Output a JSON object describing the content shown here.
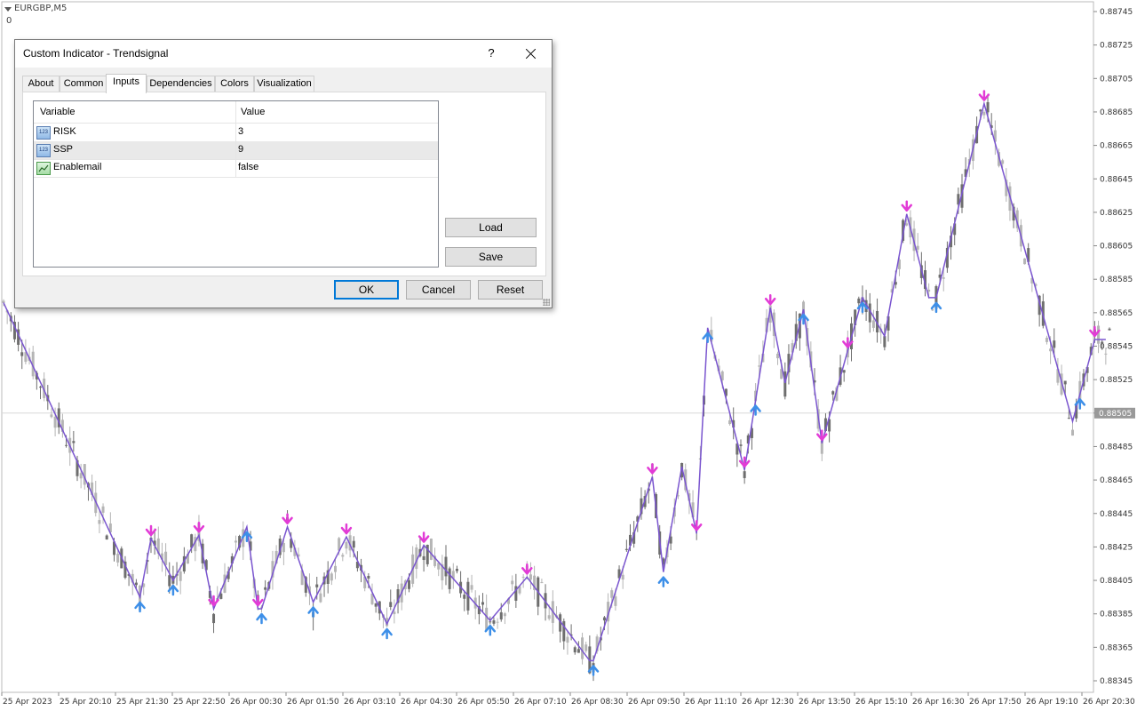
{
  "chart": {
    "symbol": "EURGBP,M5",
    "sub_label": "0",
    "current_price": "0.88505",
    "price_labels": [
      "0.88745",
      "0.88725",
      "0.88705",
      "0.88685",
      "0.88665",
      "0.88645",
      "0.88625",
      "0.88605",
      "0.88585",
      "0.88565",
      "0.88545",
      "0.88525",
      "0.88505",
      "0.88485",
      "0.88465",
      "0.88445",
      "0.88425",
      "0.88405",
      "0.88385",
      "0.88365",
      "0.88345"
    ],
    "time_labels": [
      "25 Apr 2023",
      "25 Apr 20:10",
      "25 Apr 21:30",
      "25 Apr 22:50",
      "26 Apr 00:30",
      "26 Apr 01:50",
      "26 Apr 03:10",
      "26 Apr 04:30",
      "26 Apr 05:50",
      "26 Apr 07:10",
      "26 Apr 08:30",
      "26 Apr 09:50",
      "26 Apr 11:10",
      "26 Apr 12:30",
      "26 Apr 13:50",
      "26 Apr 15:10",
      "26 Apr 16:30",
      "26 Apr 17:50",
      "26 Apr 19:10",
      "26 Apr 20:30"
    ],
    "colors": {
      "up_arrow": "#3d8fe8",
      "down_arrow": "#e23bd6",
      "zigzag": "#7a55cf",
      "candles": "#8a8a8a"
    }
  },
  "chart_data": {
    "type": "line",
    "title": "EURGBP,M5",
    "xlabel": "",
    "ylabel": "",
    "ylim": [
      0.8834,
      0.8875
    ],
    "series": [
      {
        "name": "Trendsignal",
        "x": [
          0,
          37,
          40,
          46,
          53,
          57,
          66,
          69,
          70,
          77,
          84,
          93,
          104,
          114,
          132,
          142,
          159,
          160,
          176,
          179,
          184,
          188,
          191,
          201,
          208,
          212,
          217,
          222,
          233,
          239,
          245,
          251,
          253,
          266,
          290,
          296,
          299
        ],
        "values": [
          0.88571,
          0.88395,
          0.8843,
          0.88405,
          0.88432,
          0.88388,
          0.88437,
          0.88388,
          0.88388,
          0.88437,
          0.88392,
          0.88431,
          0.88379,
          0.88426,
          0.88381,
          0.88407,
          0.88357,
          0.88357,
          0.88467,
          0.8841,
          0.88473,
          0.88433,
          0.88556,
          0.88471,
          0.88568,
          0.88523,
          0.88567,
          0.88487,
          0.88574,
          0.88551,
          0.88624,
          0.88574,
          0.88574,
          0.8869,
          0.885,
          0.88549,
          0.88549
        ]
      }
    ],
    "signals": {
      "buy_x": [
        37,
        46,
        66,
        70,
        84,
        104,
        132,
        160,
        179,
        191,
        204,
        217,
        233,
        253,
        292
      ],
      "sell_x": [
        40,
        53,
        57,
        69,
        77,
        93,
        114,
        142,
        176,
        188,
        201,
        208,
        222,
        229,
        245,
        266,
        296
      ]
    }
  },
  "dialog": {
    "title": "Custom Indicator - Trendsignal",
    "help": "?",
    "tabs": [
      "About",
      "Common",
      "Inputs",
      "Dependencies",
      "Colors",
      "Visualization"
    ],
    "active_tab": "Inputs",
    "grid": {
      "col_variable": "Variable",
      "col_value": "Value",
      "rows": [
        {
          "icon": "123",
          "name": "RISK",
          "value": "3"
        },
        {
          "icon": "123",
          "name": "SSP",
          "value": "9"
        },
        {
          "icon": "chart",
          "name": "Enablemail",
          "value": "false"
        }
      ]
    },
    "load_label": "Load",
    "save_label": "Save",
    "ok_label": "OK",
    "cancel_label": "Cancel",
    "reset_label": "Reset"
  }
}
